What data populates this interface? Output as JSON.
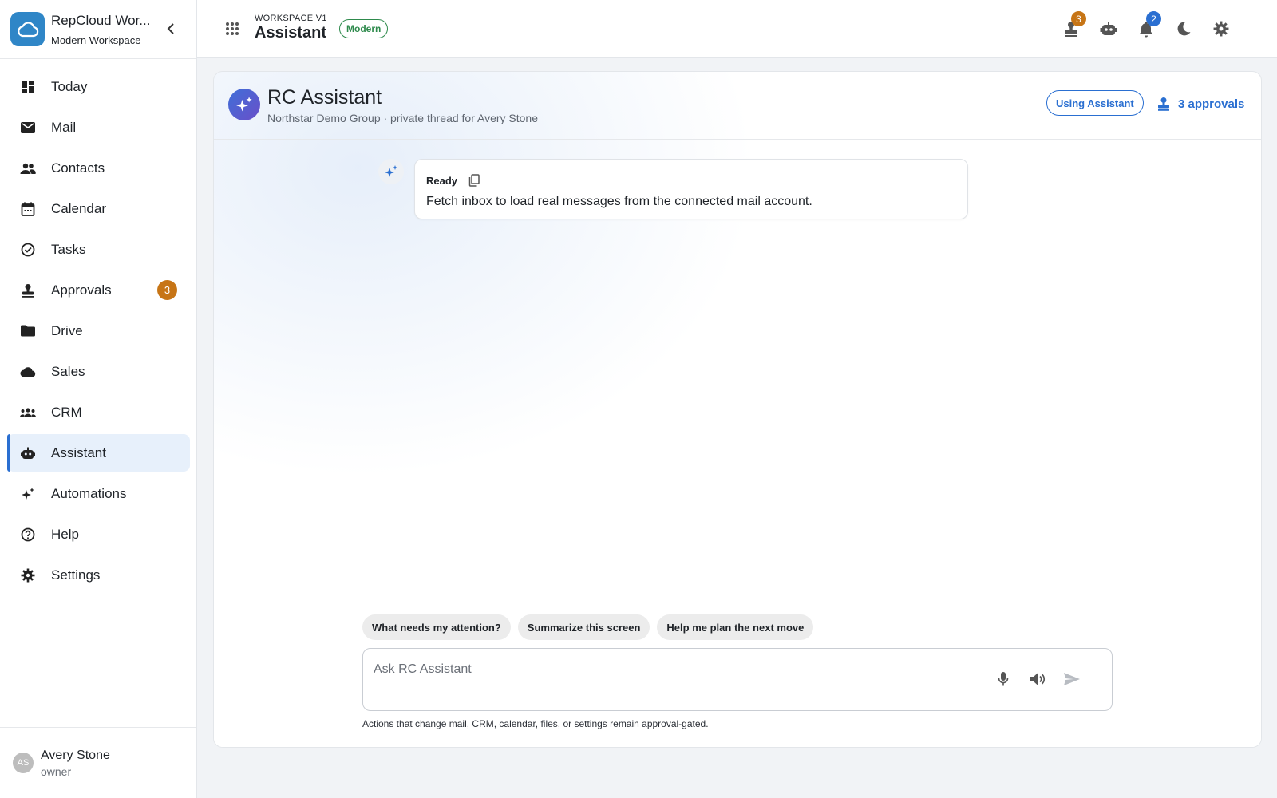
{
  "app": {
    "name": "RepCloud Wor...",
    "subtitle": "Modern Workspace"
  },
  "sidebar": {
    "items": [
      {
        "label": "Today",
        "icon": "dashboard-icon"
      },
      {
        "label": "Mail",
        "icon": "mail-icon"
      },
      {
        "label": "Contacts",
        "icon": "contacts-icon"
      },
      {
        "label": "Calendar",
        "icon": "calendar-icon"
      },
      {
        "label": "Tasks",
        "icon": "tasks-icon"
      },
      {
        "label": "Approvals",
        "icon": "approval-stamp-icon",
        "badge": "3"
      },
      {
        "label": "Drive",
        "icon": "folder-icon"
      },
      {
        "label": "Sales",
        "icon": "cloud-icon"
      },
      {
        "label": "CRM",
        "icon": "groups-icon"
      },
      {
        "label": "Assistant",
        "icon": "robot-icon",
        "active": true
      },
      {
        "label": "Automations",
        "icon": "sparkles-icon"
      },
      {
        "label": "Help",
        "icon": "help-icon"
      },
      {
        "label": "Settings",
        "icon": "gear-icon"
      }
    ]
  },
  "user": {
    "initials": "AS",
    "name": "Avery Stone",
    "role": "owner"
  },
  "header": {
    "eyebrow": "WORKSPACE V1",
    "title": "Assistant",
    "mode": "Modern",
    "approvals_badge": "3",
    "notifications_badge": "2"
  },
  "assistant": {
    "title": "RC Assistant",
    "subtitle": "Northstar Demo Group · private thread for Avery Stone",
    "using_label": "Using Assistant",
    "approvals_label": "3 approvals"
  },
  "message": {
    "status": "Ready",
    "text": "Fetch inbox to load real messages from the connected mail account."
  },
  "suggestions": [
    "What needs my attention?",
    "Summarize this screen",
    "Help me plan the next move"
  ],
  "composer": {
    "placeholder": "Ask RC Assistant",
    "value": ""
  },
  "footnote": "Actions that change mail, CRM, calendar, files, or settings remain approval-gated.",
  "colors": {
    "accent": "#2a6fd1",
    "active_bg": "#e7f0fb",
    "badge_orange": "#c77516",
    "badge_blue": "#2a6fd1",
    "mode_green": "#2e8a4c",
    "logo_blue": "#2f86c7"
  }
}
